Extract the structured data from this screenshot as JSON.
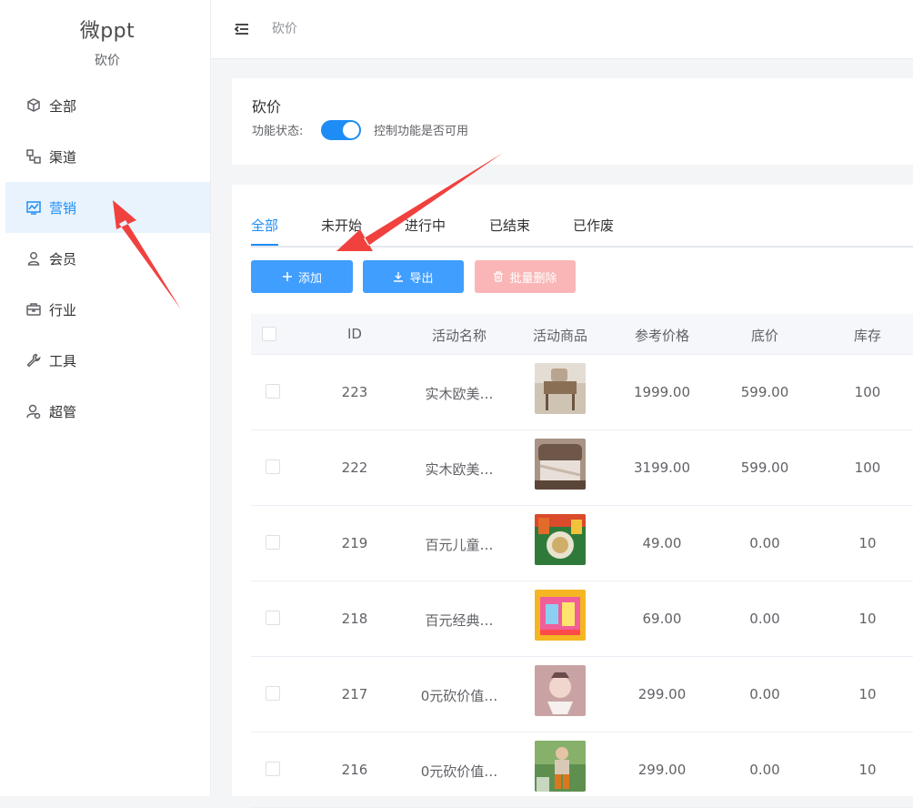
{
  "brand": {
    "name": "微ppt",
    "subtitle": "砍价"
  },
  "sidebar": {
    "collapse_glyph": "☰",
    "items": [
      {
        "label": "全部",
        "icon": "cube-icon",
        "active": false
      },
      {
        "label": "渠道",
        "icon": "channel-icon",
        "active": false
      },
      {
        "label": "营销",
        "icon": "chart-icon",
        "active": true
      },
      {
        "label": "会员",
        "icon": "user-icon",
        "active": false
      },
      {
        "label": "行业",
        "icon": "briefcase-icon",
        "active": false
      },
      {
        "label": "工具",
        "icon": "wrench-icon",
        "active": false
      },
      {
        "label": "超管",
        "icon": "admin-icon",
        "active": false
      }
    ]
  },
  "header": {
    "breadcrumb": "砍价"
  },
  "status_card": {
    "title": "砍价",
    "status_label": "功能状态:",
    "toggle_on": true,
    "toggle_desc": "控制功能是否可用"
  },
  "tabs": [
    "全部",
    "未开始",
    "进行中",
    "已结束",
    "已作废"
  ],
  "active_tab": 0,
  "buttons": {
    "add": "添加",
    "export": "导出",
    "batch_delete": "批量删除"
  },
  "table": {
    "columns": [
      "ID",
      "活动名称",
      "活动商品",
      "参考价格",
      "底价",
      "库存"
    ],
    "rows": [
      {
        "id": "223",
        "name": "实木欧美…",
        "price": "1999.00",
        "floor": "599.00",
        "stock": "100",
        "thumb": "vanity"
      },
      {
        "id": "222",
        "name": "实木欧美…",
        "price": "3199.00",
        "floor": "599.00",
        "stock": "100",
        "thumb": "bed"
      },
      {
        "id": "219",
        "name": "百元儿童…",
        "price": "49.00",
        "floor": "0.00",
        "stock": "10",
        "thumb": "food"
      },
      {
        "id": "218",
        "name": "百元经典…",
        "price": "69.00",
        "floor": "0.00",
        "stock": "10",
        "thumb": "colorful"
      },
      {
        "id": "217",
        "name": "0元砍价值…",
        "price": "299.00",
        "floor": "0.00",
        "stock": "10",
        "thumb": "baby"
      },
      {
        "id": "216",
        "name": "0元砍价值…",
        "price": "299.00",
        "floor": "0.00",
        "stock": "10",
        "thumb": "kid"
      }
    ]
  },
  "colors": {
    "primary": "#1d8df5",
    "button": "#409eff",
    "danger_disabled": "#fab6b6",
    "arrow": "#f0413e"
  }
}
